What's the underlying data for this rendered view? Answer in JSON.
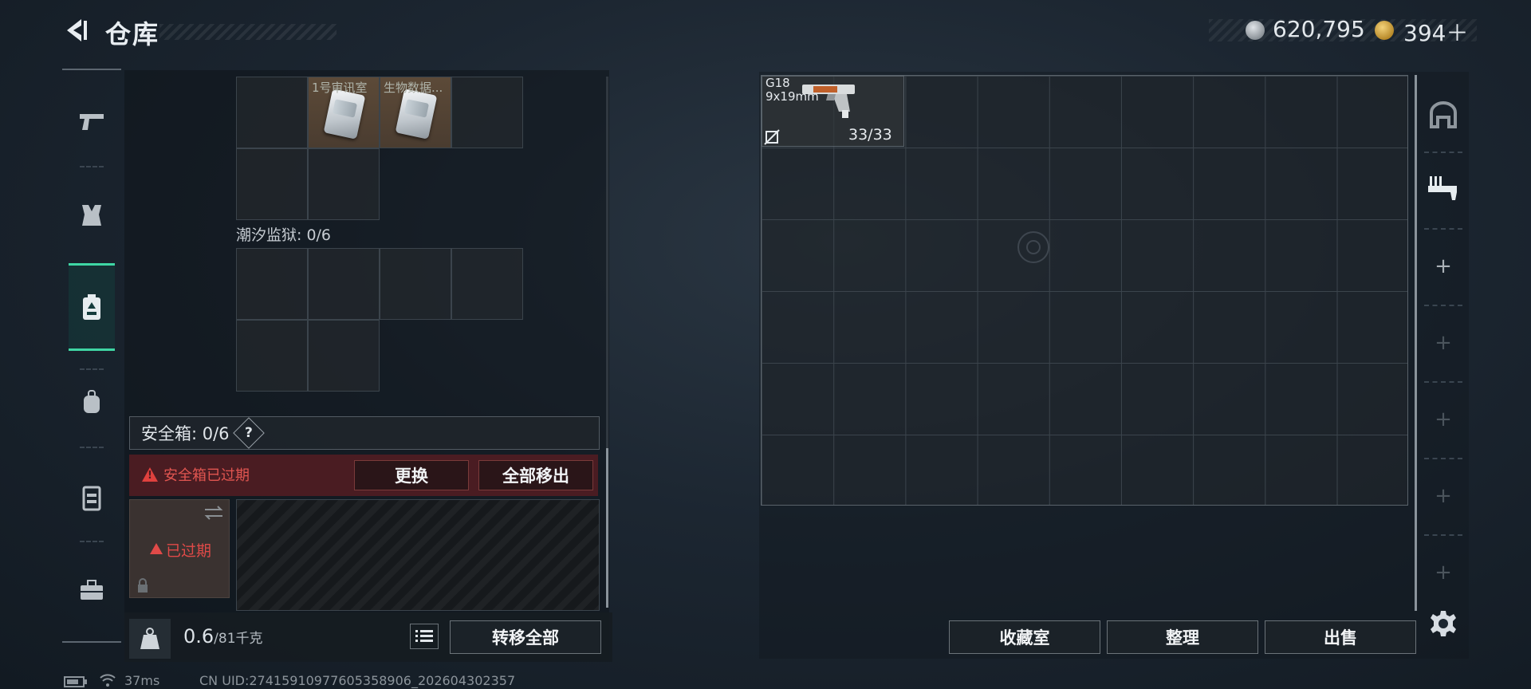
{
  "header": {
    "title": "仓库"
  },
  "currency": {
    "silver": "620,795",
    "gold": "394＋"
  },
  "left_nav": {
    "items": [
      "gun-icon",
      "armor-icon",
      "safebox-icon",
      "backpack-icon",
      "vest-icon",
      "toolbox-icon"
    ],
    "active": "safebox-icon"
  },
  "inventory": {
    "items": [
      {
        "label": "1号审讯室",
        "icon": "keycard-icon"
      },
      {
        "label": "生物数据...",
        "icon": "keycard-icon"
      }
    ],
    "section_label": "潮汐监狱: 0/6"
  },
  "safebox": {
    "label": "安全箱: 0/6",
    "help": "?",
    "alert_text": "安全箱已过期",
    "replace_label": "更换",
    "remove_all_label": "全部移出",
    "expired_label": "已过期"
  },
  "bottom": {
    "weight_value": "0.6",
    "weight_unit": "/81千克",
    "transfer_all_label": "转移全部"
  },
  "stash": {
    "weapon_name": "G18",
    "weapon_caliber": "9x19mm",
    "weapon_ammo": "33/33"
  },
  "actions": {
    "collection": "收藏室",
    "organize": "整理",
    "sell": "出售"
  },
  "side_nav": {
    "items": [
      "bunker-icon",
      "weapon-rack-icon",
      "add-icon",
      "add-icon",
      "add-icon",
      "add-icon",
      "add-icon"
    ]
  },
  "footer": {
    "ping": "37ms",
    "uid": "CN UID:27415910977605358906_202604302357"
  }
}
